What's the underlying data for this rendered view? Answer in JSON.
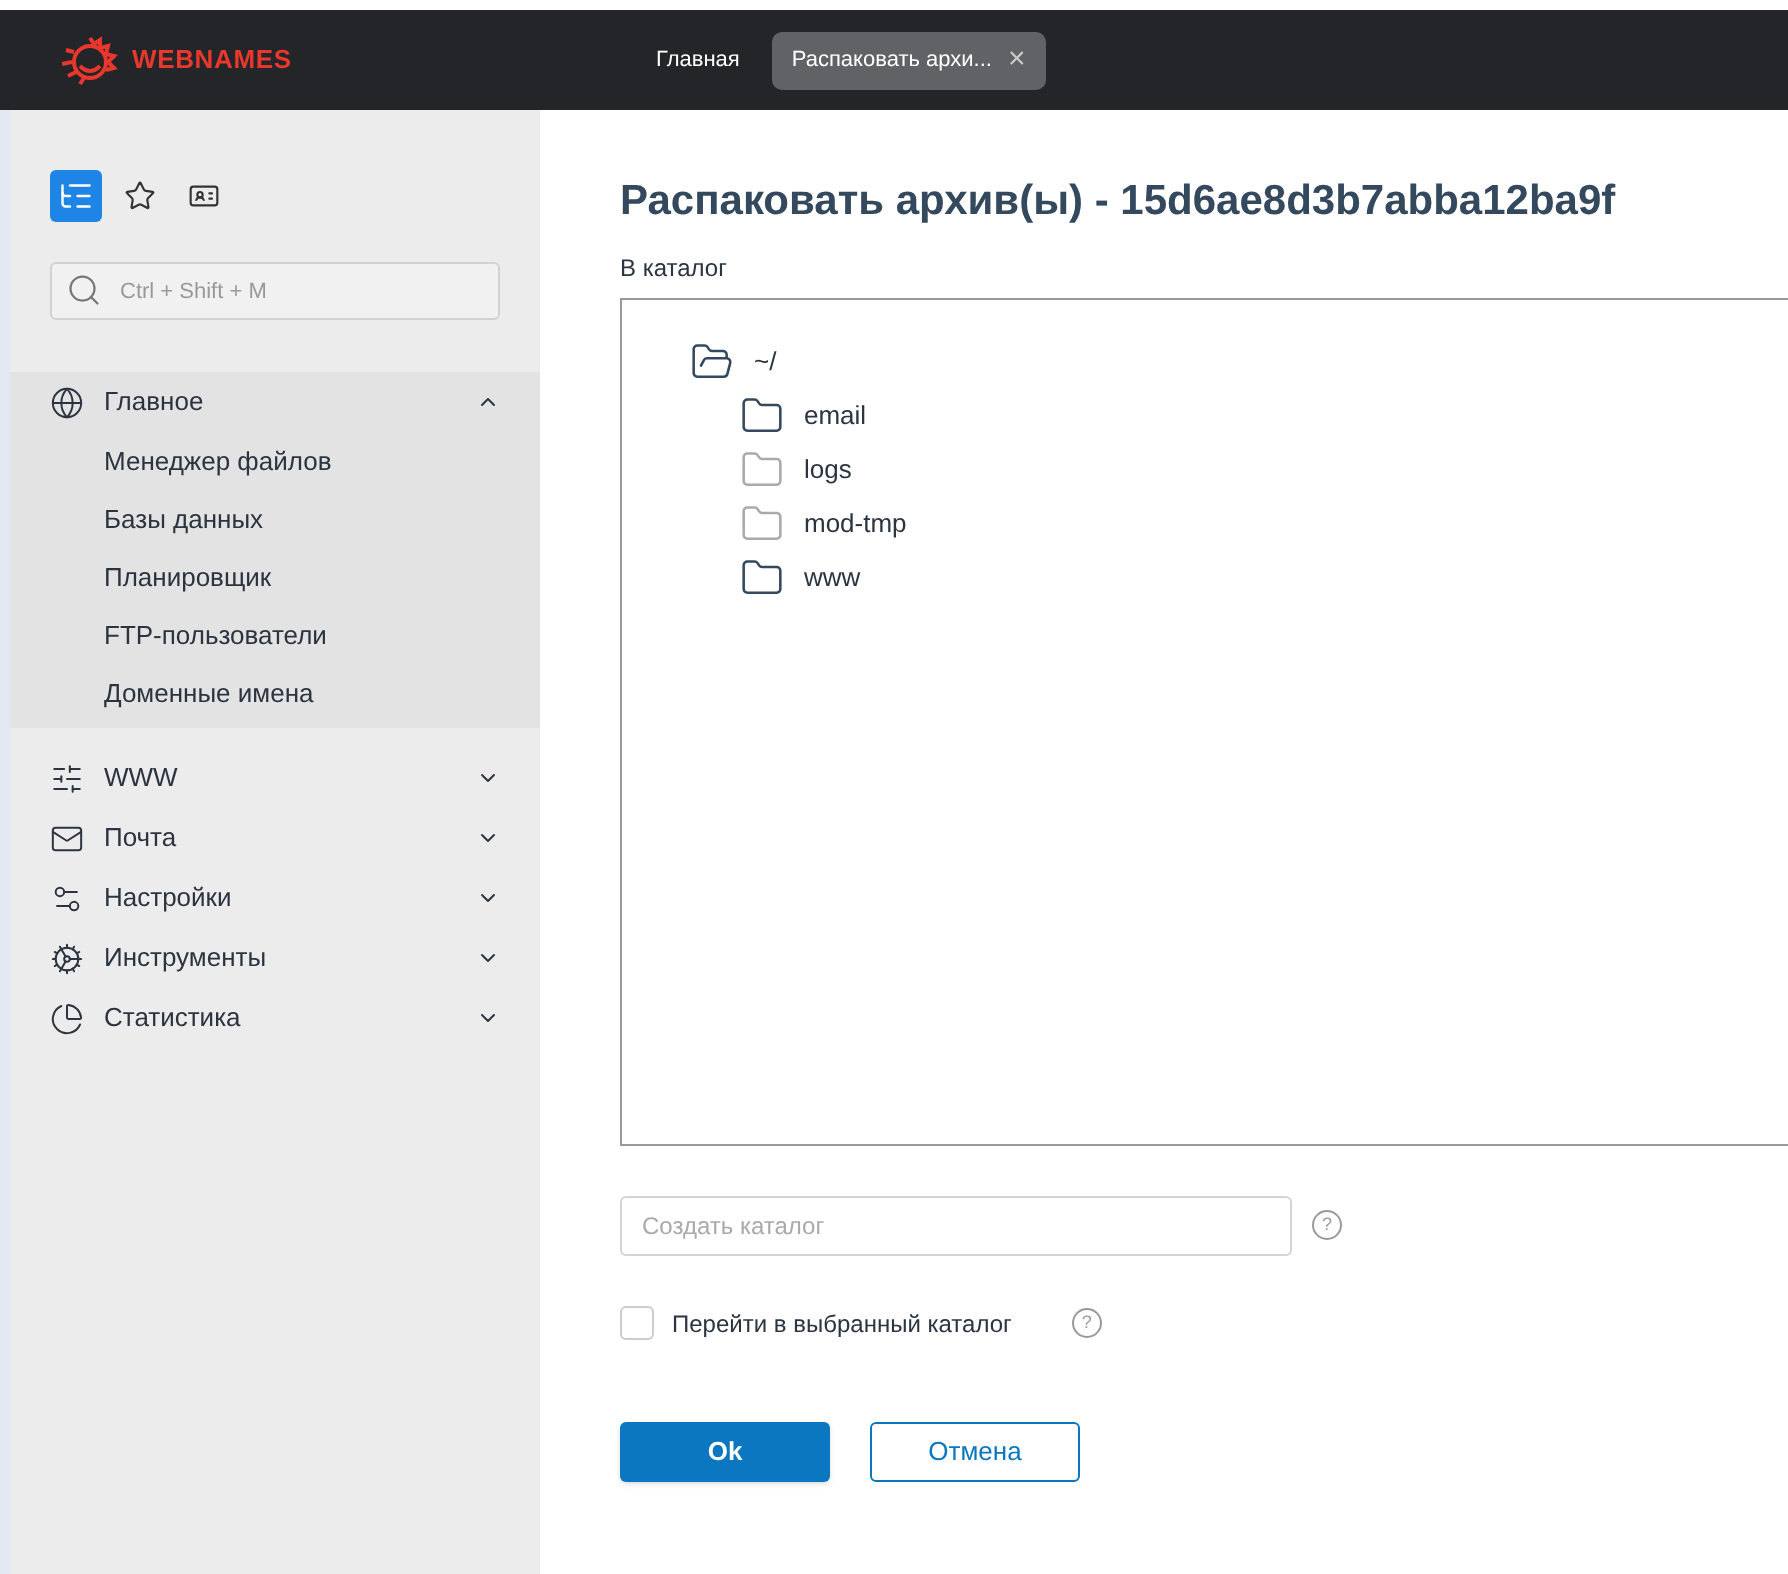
{
  "header": {
    "logo": "WEBNAMES",
    "tabs": [
      {
        "label": "Главная",
        "selected": false,
        "closable": false
      },
      {
        "label": "Распаковать архи...",
        "selected": true,
        "closable": true
      }
    ],
    "close_symbol": "×"
  },
  "sidebar": {
    "view_buttons": [
      {
        "kind": "tree",
        "selected": true
      },
      {
        "kind": "star",
        "selected": false
      },
      {
        "kind": "badge",
        "selected": false
      }
    ],
    "search": {
      "placeholder": "Ctrl + Shift + M"
    },
    "sections": [
      {
        "kind": "globe",
        "label": "Главное",
        "expanded": true,
        "children": [
          {
            "label": "Менеджер файлов"
          },
          {
            "label": "Базы данных"
          },
          {
            "label": "Планировщик"
          },
          {
            "label": "FTP-пользователи"
          },
          {
            "label": "Доменные имена"
          }
        ]
      },
      {
        "kind": "sliders",
        "label": "WWW",
        "expanded": false
      },
      {
        "kind": "mail",
        "label": "Почта",
        "expanded": false
      },
      {
        "kind": "settings",
        "label": "Настройки",
        "expanded": false
      },
      {
        "kind": "gear",
        "label": "Инструменты",
        "expanded": false
      },
      {
        "kind": "pie",
        "label": "Статистика",
        "expanded": false
      }
    ]
  },
  "main": {
    "title": "Распаковать архив(ы) - 15d6ae8d3b7abba12ba9f",
    "target_label": "В каталог",
    "tree": {
      "label": "~/",
      "children": [
        {
          "label": "email",
          "disabled": false
        },
        {
          "label": "logs",
          "disabled": true
        },
        {
          "label": "mod-tmp",
          "disabled": true
        },
        {
          "label": "www",
          "disabled": false
        }
      ]
    },
    "create_folder": {
      "placeholder": "Создать каталог"
    },
    "go_to_folder": {
      "label": "Перейти в выбранный каталог",
      "checked": false
    },
    "help_symbol": "?",
    "buttons": [
      {
        "kind": "primary",
        "label": "Ok"
      },
      {
        "kind": "secondary",
        "label": "Отмена"
      }
    ]
  }
}
